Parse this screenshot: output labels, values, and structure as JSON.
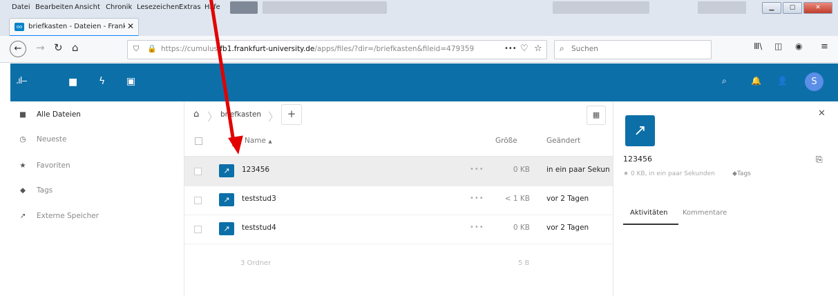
{
  "menubar": {
    "items": [
      "Datei",
      "Bearbeiten",
      "Ansicht",
      "Chronik",
      "Lesezeichen",
      "Extras",
      "Hilfe"
    ]
  },
  "tab": {
    "title": "briefkasten - Dateien - Frankfu",
    "close": "✕"
  },
  "browser": {
    "url_prefix": "https://cumulus.",
    "url_domain": "fb1.frankfurt-university.de",
    "url_path": "/apps/files/?dir=/briefkasten&fileid=479359",
    "url_more": "•••",
    "search_placeholder": "Suchen"
  },
  "app": {
    "avatar_letter": "S"
  },
  "sidebar": {
    "items": [
      {
        "label": "Alle Dateien",
        "icon": "folder-icon"
      },
      {
        "label": "Neueste",
        "icon": "clock-icon"
      },
      {
        "label": "Favoriten",
        "icon": "star-icon"
      },
      {
        "label": "Tags",
        "icon": "tag-icon"
      },
      {
        "label": "Externe Speicher",
        "icon": "external-icon"
      }
    ]
  },
  "breadcrumb": {
    "folder": "briefkasten",
    "add": "+"
  },
  "table": {
    "headers": {
      "name": "Name",
      "sort": "▲",
      "size": "Größe",
      "modified": "Geändert"
    },
    "rows": [
      {
        "name": "123456",
        "dots": "•••",
        "size": "0 KB",
        "modified": "in ein paar Sekunden"
      },
      {
        "name": "teststud3",
        "dots": "•••",
        "size": "< 1 KB",
        "modified": "vor 2 Tagen"
      },
      {
        "name": "teststud4",
        "dots": "•••",
        "size": "0 KB",
        "modified": "vor 2 Tagen"
      }
    ],
    "summary": {
      "folders": "3 Ordner",
      "size": "5 B"
    }
  },
  "details": {
    "name": "123456",
    "meta": "0 KB, in ein paar Sekunden",
    "tags": "Tags",
    "tab_activities": "Aktivitäten",
    "tab_comments": "Kommentare",
    "close": "✕"
  },
  "colors": {
    "accent": "#0d6fa8",
    "annotation": "#e20000"
  }
}
